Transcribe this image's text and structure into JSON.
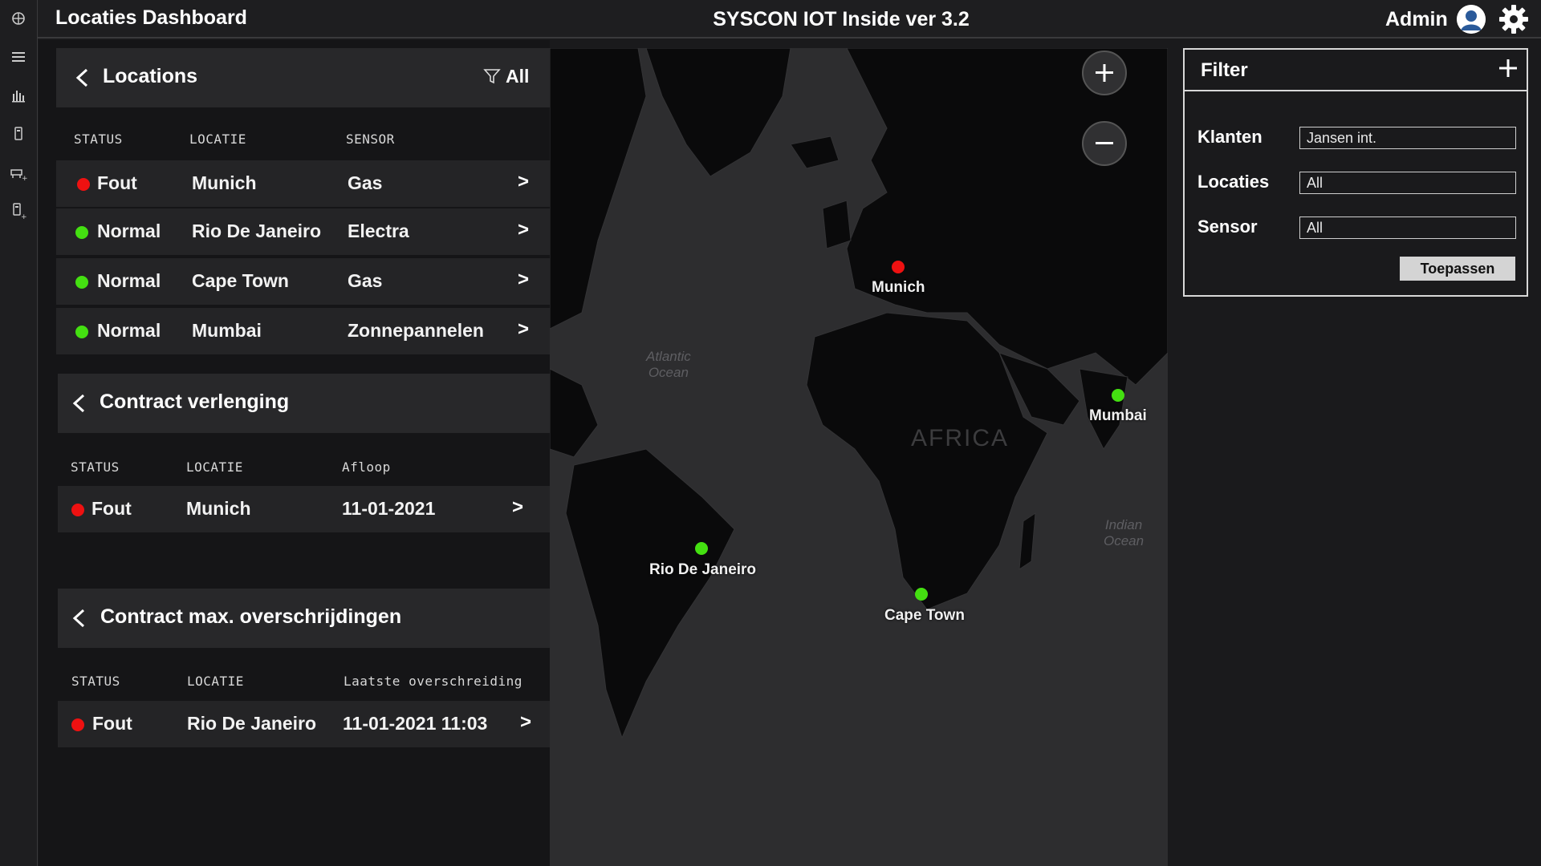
{
  "header": {
    "app_title": "Locaties Dashboard",
    "center_title": "SYSCON IOT Inside ver 3.2",
    "user_label": "Admin"
  },
  "sidebar": {
    "icons": [
      "globe-icon",
      "menu-icon",
      "bar-chart-icon",
      "device-icon",
      "add-asset-icon",
      "add-device-icon"
    ]
  },
  "locations": {
    "title": "Locations",
    "filter_label": "All",
    "columns": [
      "STATUS",
      "LOCATIE",
      "SENSOR"
    ],
    "rows": [
      {
        "status": "Fout",
        "status_color": "#ee1111",
        "locatie": "Munich",
        "sensor": "Gas",
        "arrow": ">"
      },
      {
        "status": "Normal",
        "status_color": "#44e011",
        "locatie": "Rio De Janeiro",
        "sensor": "Electra",
        "arrow": ">"
      },
      {
        "status": "Normal",
        "status_color": "#44e011",
        "locatie": "Cape Town",
        "sensor": "Gas",
        "arrow": ">"
      },
      {
        "status": "Normal",
        "status_color": "#44e011",
        "locatie": "Mumbai",
        "sensor": "Zonnepannelen",
        "arrow": ">"
      }
    ]
  },
  "contract_verlenging": {
    "title": "Contract verlenging",
    "columns": [
      "STATUS",
      "LOCATIE",
      "Afloop"
    ],
    "rows": [
      {
        "status": "Fout",
        "status_color": "#ee1111",
        "locatie": "Munich",
        "afloop": "11-01-2021",
        "arrow": ">"
      }
    ]
  },
  "contract_max": {
    "title": "Contract max. overschrijdingen",
    "columns": [
      "STATUS",
      "LOCATIE",
      "Laatste overschreiding"
    ],
    "rows": [
      {
        "status": "Fout",
        "status_color": "#ee1111",
        "locatie": "Rio De Janeiro",
        "laatste": "11-01-2021 11:03",
        "arrow": ">"
      }
    ]
  },
  "map": {
    "markers": [
      {
        "name": "Munich",
        "color": "#ee1111"
      },
      {
        "name": "Mumbai",
        "color": "#44e011"
      },
      {
        "name": "Rio De Janeiro",
        "color": "#44e011"
      },
      {
        "name": "Cape Town",
        "color": "#44e011"
      }
    ],
    "ocean_labels": [
      "Atlantic",
      "Ocean",
      "Indian",
      "Ocean"
    ],
    "continent_label": "AFRICA"
  },
  "filter": {
    "title": "Filter",
    "fields": [
      {
        "label": "Klanten",
        "value": "Jansen int."
      },
      {
        "label": "Locaties",
        "value": "All"
      },
      {
        "label": "Sensor",
        "value": "All"
      }
    ],
    "apply_label": "Toepassen"
  },
  "colors": {
    "error": "#ee1111",
    "ok": "#44e011",
    "background": "#1a1a1c"
  }
}
